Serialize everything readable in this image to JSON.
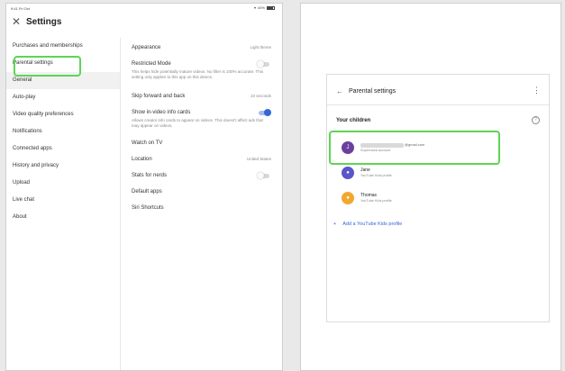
{
  "left_device": {
    "status_time": "9:41 Fri Oct",
    "status_battery": "40%",
    "header": {
      "close_icon": "close-icon",
      "title": "Settings"
    },
    "sidebar": {
      "items": [
        {
          "label": "Purchases and memberships"
        },
        {
          "label": "Parental settings"
        },
        {
          "label": "General"
        },
        {
          "label": "Auto-play"
        },
        {
          "label": "Video quality preferences"
        },
        {
          "label": "Notifications"
        },
        {
          "label": "Connected apps"
        },
        {
          "label": "History and privacy"
        },
        {
          "label": "Upload"
        },
        {
          "label": "Live chat"
        },
        {
          "label": "About"
        }
      ],
      "selected_index": 2
    },
    "general": {
      "appearance": {
        "label": "Appearance",
        "value": "Light theme"
      },
      "restricted_mode": {
        "label": "Restricted Mode",
        "desc": "This helps hide potentially mature videos. No filter is 100% accurate. This setting only applies to this app on this device.",
        "enabled": false
      },
      "skip": {
        "label": "Skip forward and back",
        "value": "10 seconds"
      },
      "info_cards": {
        "label": "Show in-video info cards",
        "desc": "Allows creator info cards to appear on videos. This doesn't affect ads that may appear on videos.",
        "enabled": true
      },
      "watch_tv": {
        "label": "Watch on TV"
      },
      "location": {
        "label": "Location",
        "value": "United States"
      },
      "stats": {
        "label": "Stats for nerds",
        "enabled": false
      },
      "default_apps": {
        "label": "Default apps"
      },
      "siri": {
        "label": "Siri Shortcuts"
      }
    }
  },
  "right_device": {
    "panel": {
      "title": "Parental settings",
      "back_icon": "back-arrow-icon",
      "more_icon": "more-vertical-icon",
      "your_children": "Your children",
      "help_icon": "help-icon",
      "children": [
        {
          "initial": "J",
          "email_domain": "@gmail.com",
          "subtitle": "Supervised account",
          "color": "#6b3fa0"
        },
        {
          "name": "Jane",
          "subtitle": "YouTube Kids profile",
          "color": "#5a55c9"
        },
        {
          "name": "Thomas",
          "subtitle": "YouTube Kids profile",
          "color": "#f0a830"
        }
      ],
      "add_label": "Add a YouTube Kids profile"
    }
  },
  "colors": {
    "highlight": "#5fd454",
    "accent": "#3367d6"
  }
}
